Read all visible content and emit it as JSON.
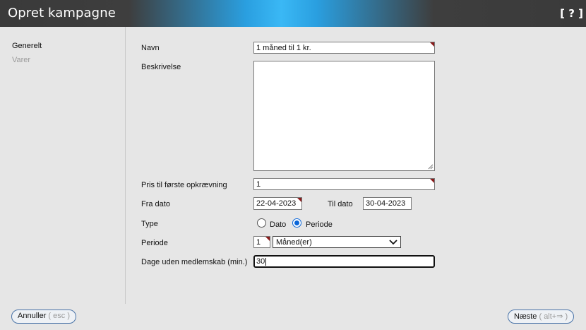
{
  "header": {
    "title": "Opret kampagne",
    "help": "[ ? ]"
  },
  "sidebar": {
    "items": [
      {
        "label": "Generelt"
      },
      {
        "label": "Varer"
      }
    ]
  },
  "form": {
    "navn": {
      "label": "Navn",
      "value": "1 måned til 1 kr."
    },
    "beskrivelse": {
      "label": "Beskrivelse",
      "value": ""
    },
    "pris": {
      "label": "Pris til første opkrævning",
      "value": "1"
    },
    "fra_dato": {
      "label": "Fra dato",
      "value": "22-04-2023"
    },
    "til_dato": {
      "label": "Til dato",
      "value": "30-04-2023"
    },
    "type": {
      "label": "Type",
      "options": [
        "Dato",
        "Periode"
      ],
      "selected": "Periode"
    },
    "periode": {
      "label": "Periode",
      "count": "1",
      "unit": "Måned(er)"
    },
    "dage": {
      "label": "Dage uden medlemskab (min.)",
      "value": "30"
    }
  },
  "footer": {
    "cancel": {
      "label": "Annuller",
      "hint": "( esc )"
    },
    "next": {
      "label": "Næste",
      "hint": "( alt+⇒ )"
    }
  },
  "colors": {
    "required_marker": "#8b1a1a",
    "accent": "#0a66d8",
    "button_border": "#4a74a8"
  }
}
